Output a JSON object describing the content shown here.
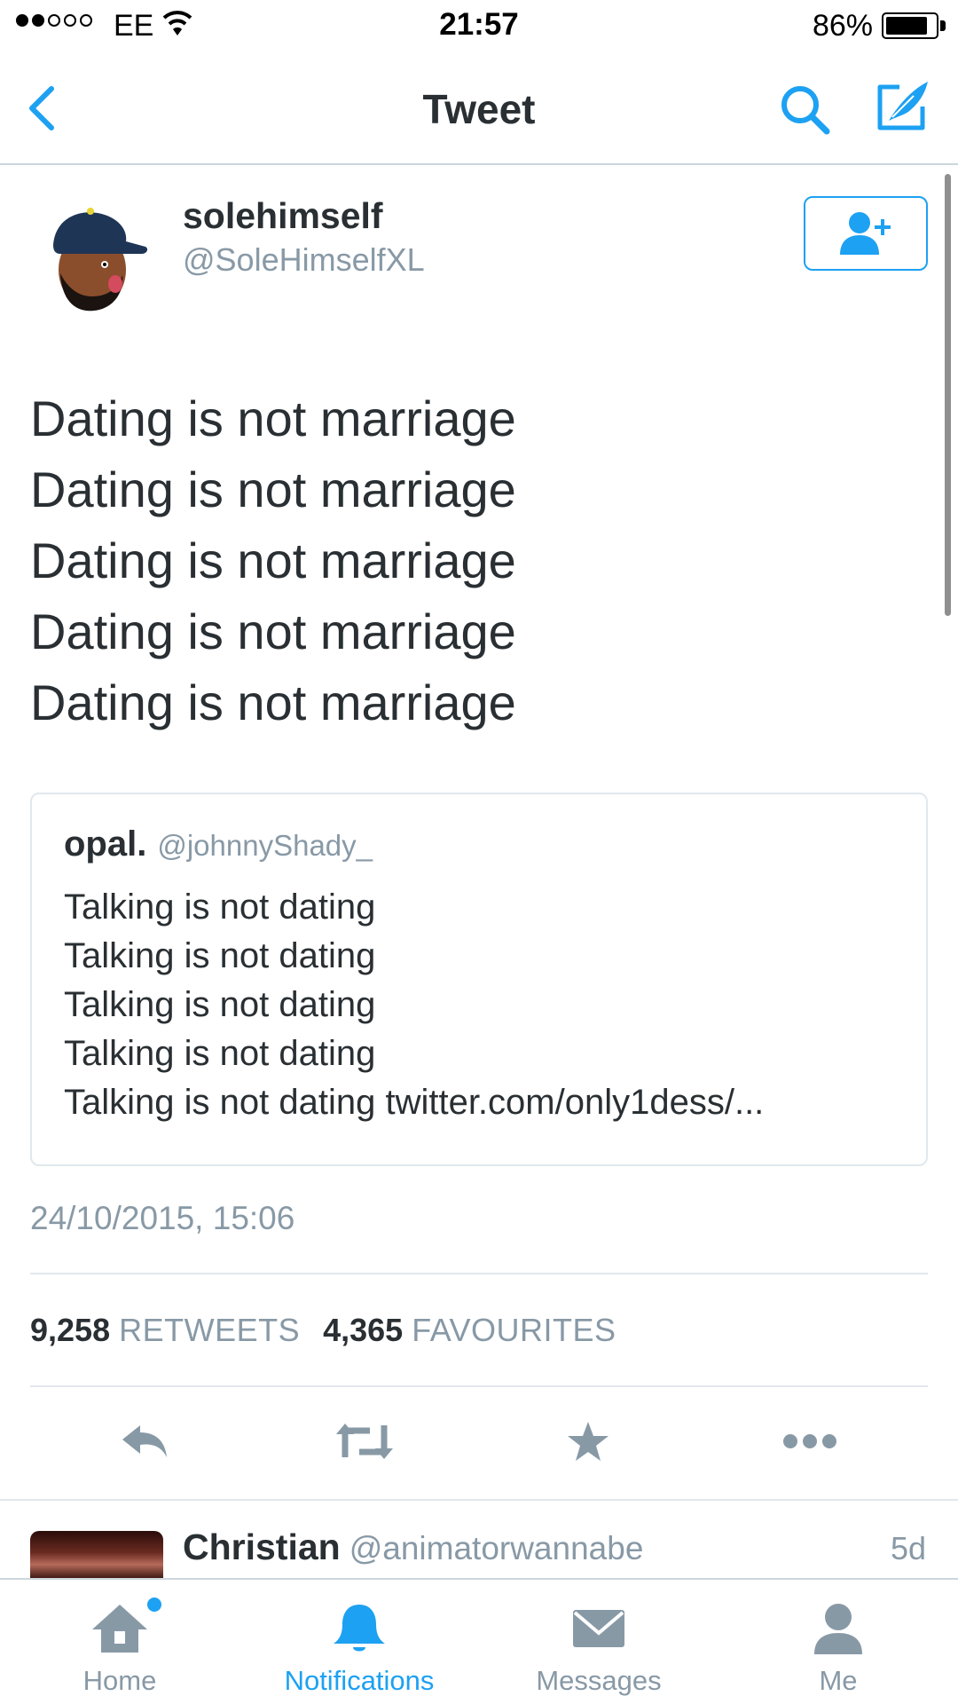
{
  "status_bar": {
    "carrier": "EE",
    "time": "21:57",
    "battery": "86%",
    "battery_level": 0.86,
    "signal_filled": 2,
    "signal_total": 5
  },
  "navbar": {
    "title": "Tweet",
    "back_icon": "chevron-left-icon",
    "search_icon": "search-icon",
    "compose_icon": "compose-icon"
  },
  "tweet": {
    "author_name": "solehimself",
    "author_handle": "@SoleHimselfXL",
    "follow_icon": "add-user-icon",
    "lines": [
      "Dating is not marriage",
      "Dating is not marriage",
      "Dating is not marriage",
      "Dating is not marriage",
      "Dating is not marriage"
    ],
    "quote": {
      "name": "opal.",
      "handle": "@johnnyShady_",
      "lines": [
        "Talking is not dating",
        "Talking is not dating",
        "Talking is not dating",
        "Talking is not dating",
        "Talking is not dating"
      ],
      "link": "twitter.com/only1dess/..."
    },
    "timestamp": "24/10/2015, 15:06",
    "retweets_count": "9,258",
    "retweets_label": "RETWEETS",
    "favourites_count": "4,365",
    "favourites_label": "FAVOURITES"
  },
  "actions": [
    "reply-icon",
    "retweet-icon",
    "star-icon",
    "more-icon"
  ],
  "reply_preview": {
    "name": "Christian",
    "handle": "@animatorwannabe",
    "time": "5d"
  },
  "tabbar": {
    "tabs": [
      {
        "label": "Home",
        "icon": "home-icon",
        "has_dot": true
      },
      {
        "label": "Notifications",
        "icon": "bell-icon",
        "active": true
      },
      {
        "label": "Messages",
        "icon": "envelope-icon"
      },
      {
        "label": "Me",
        "icon": "person-icon"
      }
    ]
  },
  "colors": {
    "accent": "#1da1f2",
    "text": "#292f33",
    "secondary": "#8899a6",
    "border": "#e1e8ed"
  }
}
